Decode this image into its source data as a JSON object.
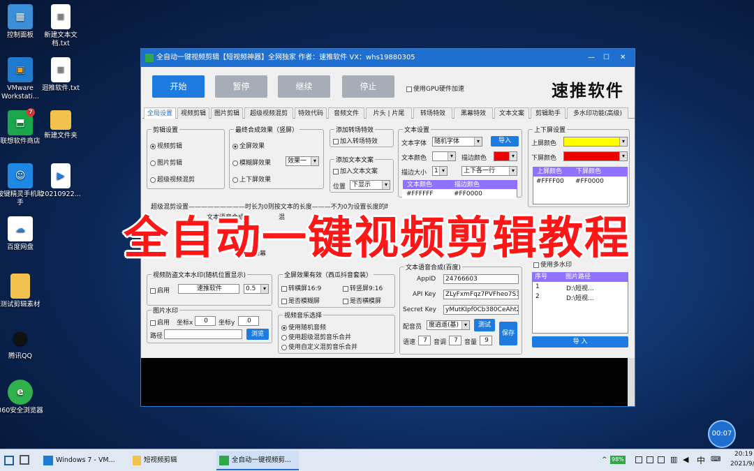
{
  "desktop": {
    "icons": [
      {
        "label": "控制面板"
      },
      {
        "label": "新建文本文档.txt"
      },
      {
        "label": "VMware Workstati..."
      },
      {
        "label": "迴推软件.txt"
      },
      {
        "label": "联想软件商店",
        "badge": "7"
      },
      {
        "label": "新建文件夹"
      },
      {
        "label": "按键精灵手机助手"
      },
      {
        "label": "20210922..."
      },
      {
        "label": "百度网盘"
      },
      {
        "label": "测试剪辑素材"
      },
      {
        "label": "腾讯QQ"
      },
      {
        "label": "360安全浏览器"
      }
    ]
  },
  "window": {
    "title": "全自动一键视频剪辑【短视频神器】全网独家    作者：速推软件    VX：whs19880305",
    "controls": {
      "min": "—",
      "max": "☐",
      "close": "✕"
    },
    "actions": {
      "start": "开始",
      "pause": "暂停",
      "resume": "继续",
      "stop": "停止"
    },
    "gpu_label": "使用GPU硬件加速",
    "brand": "速推软件",
    "tabs": [
      "全局设置",
      "视频剪辑",
      "图片剪辑",
      "超级视频混剪",
      "特效代码",
      "音频文件",
      "片头 | 片尾",
      "转场特效",
      "黑幕特效",
      "文本文案",
      "剪辑助手",
      "多水印功能(高级)"
    ],
    "edit_settings": {
      "title": "剪辑设置",
      "options": [
        "视频剪辑",
        "图片剪辑",
        "超级视频混剪"
      ],
      "selected": 0
    },
    "final_effect": {
      "title": "最终合成效果（竖屏）",
      "options": [
        "全屏效果",
        "模糊屏效果",
        "上下屏效果"
      ],
      "selected": 0,
      "blur_value": "效果一"
    },
    "transition": {
      "title": "添加转场特效",
      "checkbox": "加入转场特效"
    },
    "text_copy": {
      "title": "添加文本文案",
      "checkbox": "加入文本文案",
      "pos_label": "位置",
      "pos_value": "下显示"
    },
    "text_settings": {
      "title": "文本设置",
      "font_label": "文本字体",
      "font_value": "随机字体",
      "import": "导入",
      "color_label": "文本颜色",
      "stroke_label": "描边颜色",
      "size_label": "描边大小",
      "size_value": "1",
      "align_value": "上下各一行",
      "col1": "文本颜色",
      "col2": "描边颜色",
      "row1": "#FFFFFF",
      "row2": "#FF0000"
    },
    "screen_settings": {
      "title": "上下屏设置",
      "top_label": "上屏颜色",
      "bottom_label": "下屏颜色",
      "col1": "上屏颜色",
      "col2": "下屏颜色",
      "row1": "#FFFF00",
      "row2": "#FF0000",
      "top_color": "#ffff00",
      "bottom_color": "#ff0000"
    },
    "mix_line": "超级混剪设置—————————时长为0则按文本的长度———不为0为设置长度的时长",
    "mix_opts": [
      "剪辑",
      "文本语音合成",
      "混"
    ],
    "add_frame": "加绿幕",
    "watermark": {
      "title": "视频防盗文本水印(随机位置显示)",
      "enable": "启用",
      "text": "速推软件",
      "value": "0.5"
    },
    "image_wm": {
      "title": "图片水印",
      "enable": "启用",
      "x_label": "坐标x",
      "x_value": "0",
      "y_label": "坐标y",
      "y_value": "0",
      "path_label": "路径",
      "browse": "浏览"
    },
    "fullscreen": {
      "title": "全屏效果有效（西瓜抖音套装）",
      "opt1": "转横屏16:9",
      "opt2": "转竖屏9:16",
      "opt3": "是否模糊屏",
      "opt4": "是否横模屏"
    },
    "music": {
      "title": "视频音乐选择",
      "options": [
        "使用随机音频",
        "使用超级混剪音乐合并",
        "使用自定义混剪音乐合并"
      ],
      "selected": 0
    },
    "voice": {
      "title": "文本语音合成(百度)",
      "appid_label": "AppID",
      "appid": "24766603",
      "apikey_label": "API Key",
      "apikey": "ZLyFxmFqz7PVFheo7S1UN",
      "secret_label": "Secret Key",
      "secret": "yMutKIpf0Cb380CeAht21",
      "speaker_label": "配音员",
      "speaker": "度逍遥(基)",
      "test": "测试",
      "save": "保存",
      "speed_label": "语速",
      "speed": "7",
      "tone_label": "音调",
      "tone": "7",
      "vol_label": "音量",
      "vol": "9"
    },
    "multi_wm": {
      "check": "使用多水印",
      "col1": "序号",
      "col2": "图片路径",
      "rows": [
        [
          "1",
          "D:\\短视..."
        ],
        [
          "2",
          "D:\\短视..."
        ]
      ],
      "import": "导 入"
    }
  },
  "overlay_text": "全自动一键视频剪辑教程",
  "timer": "00:07",
  "taskbar": {
    "items": [
      "Windows 7 - VM...",
      "短视频剪辑",
      "全自动一键视频剪..."
    ],
    "battery": "98%",
    "ime": "中",
    "time": "20:19",
    "date": "2021/9/"
  }
}
